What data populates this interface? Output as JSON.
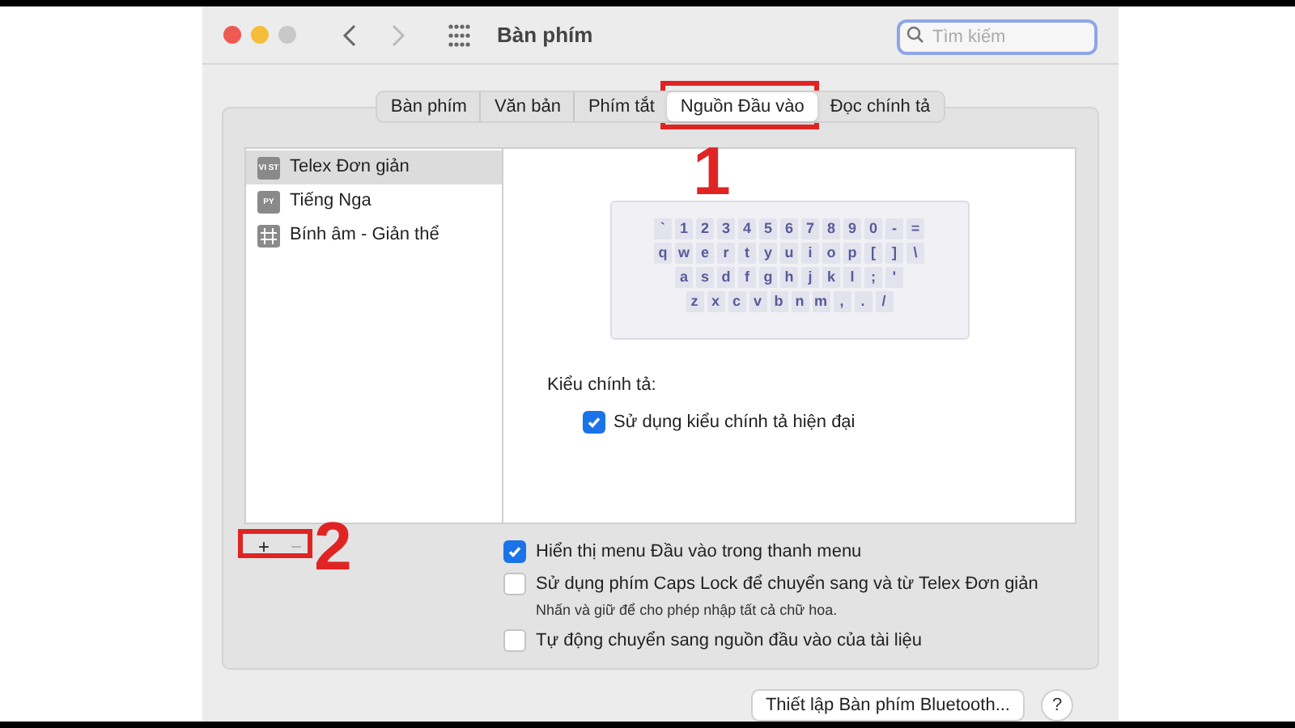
{
  "window": {
    "title": "Bàn phím"
  },
  "search": {
    "placeholder": "Tìm kiếm"
  },
  "tabs": [
    {
      "label": "Bàn phím",
      "selected": false
    },
    {
      "label": "Văn bản",
      "selected": false
    },
    {
      "label": "Phím tắt",
      "selected": false
    },
    {
      "label": "Nguồn Đầu vào",
      "selected": true
    },
    {
      "label": "Đọc chính tả",
      "selected": false
    }
  ],
  "sources": [
    {
      "kind": "badge",
      "badge": "VI ST",
      "name": "Telex Đơn giản",
      "selected": true
    },
    {
      "kind": "badge",
      "badge": "PY",
      "name": "Tiếng Nga",
      "selected": false
    },
    {
      "kind": "grid",
      "name": "Bính âm - Giản thể",
      "selected": false
    }
  ],
  "keyboard_rows": [
    [
      "`",
      "1",
      "2",
      "3",
      "4",
      "5",
      "6",
      "7",
      "8",
      "9",
      "0",
      "-",
      "="
    ],
    [
      "q",
      "w",
      "e",
      "r",
      "t",
      "y",
      "u",
      "i",
      "o",
      "p",
      "[",
      "]",
      "\\"
    ],
    [
      "a",
      "s",
      "d",
      "f",
      "g",
      "h",
      "j",
      "k",
      "l",
      ";",
      "'"
    ],
    [
      "z",
      "x",
      "c",
      "v",
      "b",
      "n",
      "m",
      ",",
      ".",
      "/"
    ]
  ],
  "spelling": {
    "label": "Kiểu chính tả:",
    "option": {
      "label": "Sử dụng kiểu chính tả hiện đại",
      "checked": true
    }
  },
  "list_buttons": [
    "+",
    "−"
  ],
  "options": [
    {
      "label": "Hiển thị menu Đầu vào trong thanh menu",
      "checked": true
    },
    {
      "label": "Sử dụng phím Caps Lock để chuyển sang và từ Telex Đơn giản",
      "checked": false,
      "note": "Nhấn và giữ để cho phép nhập tất cả chữ hoa."
    },
    {
      "label": "Tự động chuyển sang nguồn đầu vào của tài liệu",
      "checked": false
    }
  ],
  "bluetooth_button": "Thiết lập Bàn phím Bluetooth...",
  "help_button": "?",
  "annotations": [
    "1",
    "2"
  ]
}
